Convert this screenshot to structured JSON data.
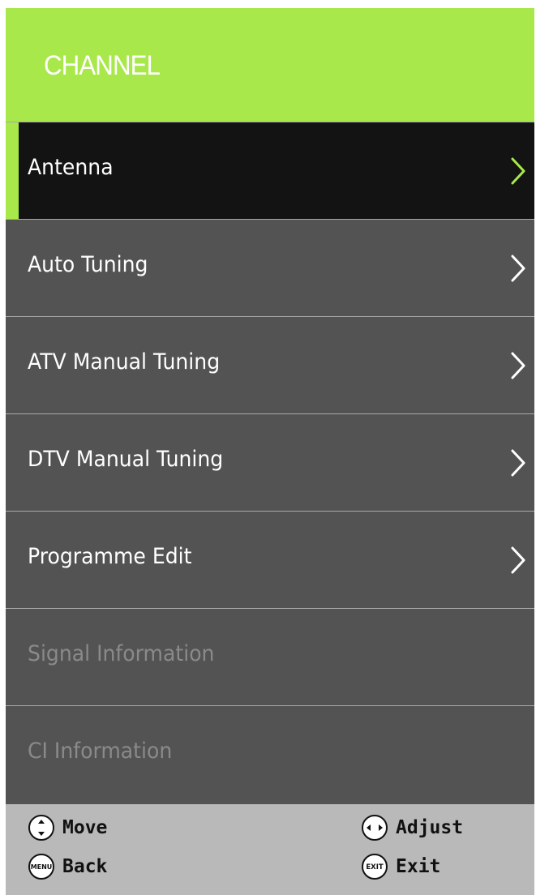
{
  "header": {
    "title": "CHANNEL"
  },
  "colors": {
    "accent": "#a8e84a",
    "item_bg": "#535353",
    "selected_bg": "#131313",
    "footer_bg": "#b9b9b9",
    "disabled_text": "#8a8a8a"
  },
  "menu": {
    "items": [
      {
        "label": "Antenna",
        "selected": true,
        "enabled": true,
        "has_submenu": true
      },
      {
        "label": "Auto Tuning",
        "selected": false,
        "enabled": true,
        "has_submenu": true
      },
      {
        "label": "ATV Manual Tuning",
        "selected": false,
        "enabled": true,
        "has_submenu": true
      },
      {
        "label": "DTV Manual Tuning",
        "selected": false,
        "enabled": true,
        "has_submenu": true
      },
      {
        "label": "Programme Edit",
        "selected": false,
        "enabled": true,
        "has_submenu": true
      },
      {
        "label": "Signal Information",
        "selected": false,
        "enabled": false,
        "has_submenu": false
      },
      {
        "label": "CI Information",
        "selected": false,
        "enabled": false,
        "has_submenu": false
      }
    ]
  },
  "footer": {
    "move": {
      "icon": "up-down-icon",
      "label": "Move"
    },
    "back": {
      "icon": "menu-key-icon",
      "icon_text": "MENU",
      "label": "Back"
    },
    "adjust": {
      "icon": "left-right-icon",
      "label": "Adjust"
    },
    "exit": {
      "icon": "exit-key-icon",
      "icon_text": "EXIT",
      "label": "Exit"
    }
  }
}
